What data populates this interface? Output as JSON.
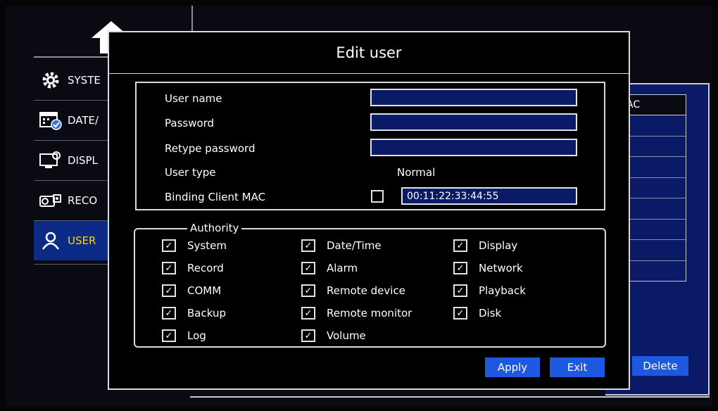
{
  "sidebar": {
    "items": [
      {
        "label": "SYSTE",
        "icon": "gear-icon"
      },
      {
        "label": "DATE/",
        "icon": "calendar-icon"
      },
      {
        "label": "DISPL",
        "icon": "monitor-icon"
      },
      {
        "label": "RECO",
        "icon": "camera-icon"
      },
      {
        "label": "USER",
        "icon": "user-icon",
        "active": true
      }
    ]
  },
  "background_table": {
    "header": "AC"
  },
  "background_buttons": {
    "delete_label": "Delete"
  },
  "dialog": {
    "title": "Edit user",
    "form": {
      "user_name_label": "User name",
      "user_name_value": "",
      "password_label": "Password",
      "password_value": "",
      "retype_password_label": "Retype password",
      "retype_password_value": "",
      "user_type_label": "User type",
      "user_type_value": "Normal",
      "binding_mac_label": "Binding Client MAC",
      "binding_mac_checked": false,
      "mac_value": "00:11:22:33:44:55"
    },
    "authority": {
      "legend": "Authority",
      "items": [
        {
          "label": "System",
          "checked": true
        },
        {
          "label": "Date/Time",
          "checked": true
        },
        {
          "label": "Display",
          "checked": true
        },
        {
          "label": "Record",
          "checked": true
        },
        {
          "label": "Alarm",
          "checked": true
        },
        {
          "label": "Network",
          "checked": true
        },
        {
          "label": "COMM",
          "checked": true
        },
        {
          "label": "Remote device",
          "checked": true
        },
        {
          "label": "Playback",
          "checked": true
        },
        {
          "label": "Backup",
          "checked": true
        },
        {
          "label": "Remote monitor",
          "checked": true
        },
        {
          "label": "Disk",
          "checked": true
        },
        {
          "label": "Log",
          "checked": true
        },
        {
          "label": "Volume",
          "checked": true
        }
      ]
    },
    "buttons": {
      "apply_label": "Apply",
      "exit_label": "Exit"
    }
  },
  "colors": {
    "accent_blue": "#1e58e0",
    "field_bg": "#0a1a66",
    "active_text": "#ffd21a"
  }
}
